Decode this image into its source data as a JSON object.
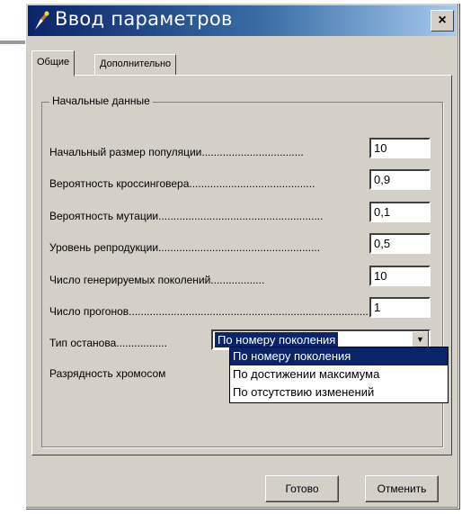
{
  "window": {
    "title": "Ввод параметров",
    "close_symbol": "×"
  },
  "tabs": [
    {
      "label": "Общие",
      "active": true
    },
    {
      "label": "Дополнительно",
      "active": false
    }
  ],
  "group": {
    "title": "Начальные данные",
    "fields": [
      {
        "label": "Начальный размер популяции",
        "value": "10"
      },
      {
        "label": "Вероятность кроссинговера",
        "value": "0,9"
      },
      {
        "label": "Вероятность мутации",
        "value": "0,1"
      },
      {
        "label": "Уровень репродукции",
        "value": "0,5"
      },
      {
        "label": "Число генерируемых поколений",
        "value": "10"
      },
      {
        "label": "Число прогонов",
        "value": "1"
      }
    ],
    "stop_type": {
      "label": "Тип останова",
      "selected": "По номеру поколения",
      "options": [
        "По номеру поколения",
        "По достижении максимума",
        "По отсутствию изменений"
      ]
    },
    "chromosome_label": "Разрядность хромосом"
  },
  "buttons": {
    "ok_label": "Готово",
    "cancel_label": "Отменить"
  },
  "colors": {
    "title_bar": "#0a246a",
    "face": "#d4d0c8",
    "selection": "#0a246a"
  }
}
